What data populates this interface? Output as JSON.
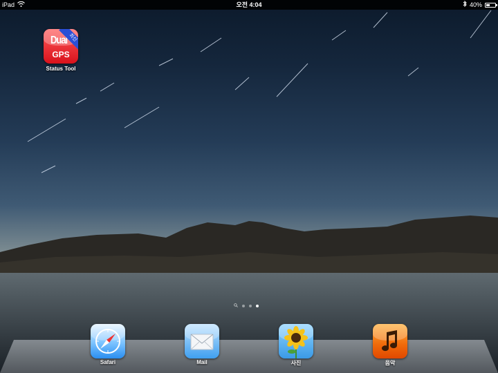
{
  "status_bar": {
    "device": "iPad",
    "time": "오전 4:04",
    "battery": "40%",
    "battery_level": 0.4
  },
  "home_apps": [
    {
      "name": "Status Tool",
      "icon": "dual-gps-icon",
      "icon_text_top": "Dual",
      "icon_text_bottom": "GPS",
      "icon_ribbon": "최신"
    }
  ],
  "page_indicator": {
    "pages": 3,
    "current": 3,
    "search_icon": "search-icon"
  },
  "dock": {
    "apps": [
      {
        "label": "Safari",
        "icon": "compass-icon"
      },
      {
        "label": "Mail",
        "icon": "envelope-icon"
      },
      {
        "label": "사진",
        "icon": "sunflower-icon"
      },
      {
        "label": "음악",
        "icon": "music-note-icon"
      }
    ]
  },
  "colors": {
    "gps_red": "#d9121c",
    "ribbon_blue": "#2b4fd6",
    "music_orange": "#f06a0a"
  }
}
